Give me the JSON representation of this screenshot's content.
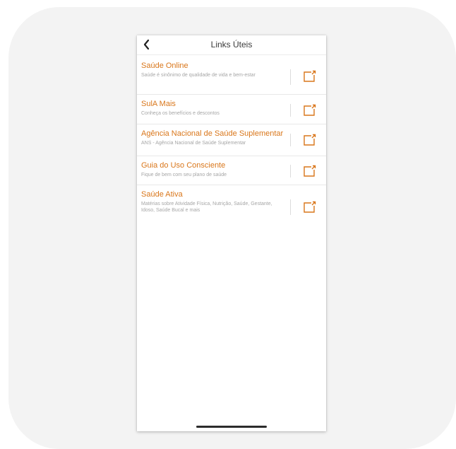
{
  "header": {
    "title": "Links Úteis",
    "back_icon": "chevron-left-icon"
  },
  "links": [
    {
      "title": "Saúde Online",
      "subtitle": "Saúde é sinônimo de qualidade de vida e bem-estar",
      "icon": "external-link-icon"
    },
    {
      "title": "SulA Mais",
      "subtitle": "Conheça os benefícios e descontos",
      "icon": "external-link-icon"
    },
    {
      "title": "Agência Nacional de Saúde Suplementar",
      "subtitle": "ANS - Agência Nacional de Saúde Suplementar",
      "icon": "external-link-icon"
    },
    {
      "title": "Guia do Uso Consciente",
      "subtitle": "Fique de bem com seu plano de saúde",
      "icon": "external-link-icon"
    },
    {
      "title": "Saúde Ativa",
      "subtitle": "Matérias sobre Atividade Física, Nutrição, Saúde, Gestante, Idoso, Saúde Bucal e mais",
      "icon": "external-link-icon"
    }
  ],
  "colors": {
    "accent": "#d9761a",
    "title_text": "#3a3a3a",
    "subtitle_text": "#a6a6a6",
    "backdrop": "#f3f3f3"
  }
}
